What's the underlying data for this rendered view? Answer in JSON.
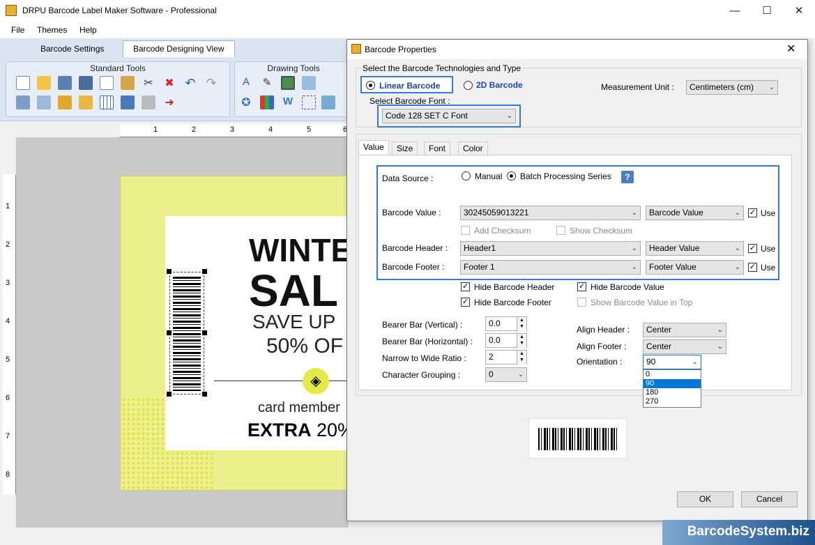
{
  "window": {
    "title": "DRPU Barcode Label Maker Software - Professional"
  },
  "menu": {
    "file": "File",
    "themes": "Themes",
    "help": "Help"
  },
  "tabs": {
    "barcode_settings": "Barcode Settings",
    "designing_view": "Barcode Designing View"
  },
  "ribbon": {
    "standard_tools": "Standard Tools",
    "drawing_tools": "Drawing Tools"
  },
  "ruler": {
    "top": [
      "1",
      "2",
      "3",
      "4",
      "5",
      "6"
    ],
    "left": [
      "1",
      "2",
      "3",
      "4",
      "5",
      "6",
      "7",
      "8"
    ]
  },
  "label": {
    "line1": "WINTE",
    "line2": "SAL",
    "line3": "SAVE UP",
    "line4": "50% OF",
    "line5": "card member",
    "line6_bold": "EXTRA",
    "line6_rest": "20%"
  },
  "dialog": {
    "title": "Barcode Properties",
    "tech_group": "Select the Barcode Technologies and Type",
    "linear": "Linear Barcode",
    "twod": "2D Barcode",
    "measurement_label": "Measurement Unit :",
    "measurement_value": "Centimeters (cm)",
    "font_label": "Select Barcode Font :",
    "font_value": "Code 128 SET C Font",
    "tabs": {
      "value": "Value",
      "size": "Size",
      "font": "Font",
      "color": "Color"
    },
    "data_source_label": "Data Source :",
    "manual": "Manual",
    "batch": "Batch Processing Series",
    "help": "?",
    "barcode_value_label": "Barcode Value :",
    "barcode_value": "30245059013221",
    "barcode_value_src": "Barcode Value",
    "use": "Use",
    "add_checksum": "Add Checksum",
    "show_checksum": "Show Checksum",
    "header_label": "Barcode Header :",
    "header_value": "Header1",
    "header_src": "Header Value",
    "footer_label": "Barcode Footer :",
    "footer_value": "Footer 1",
    "footer_src": "Footer Value",
    "hide_header": "Hide Barcode Header",
    "hide_value": "Hide Barcode Value",
    "hide_footer": "Hide Barcode Footer",
    "show_value_top": "Show Barcode Value in Top",
    "bearer_v_label": "Bearer Bar (Vertical) :",
    "bearer_v": "0.0",
    "bearer_h_label": "Bearer Bar (Horizontal) :",
    "bearer_h": "0.0",
    "ratio_label": "Narrow to Wide Ratio :",
    "ratio": "2",
    "grouping_label": "Character Grouping :",
    "grouping": "0",
    "align_header_label": "Align Header :",
    "align_header": "Center",
    "align_footer_label": "Align Footer :",
    "align_footer": "Center",
    "orientation_label": "Orientation :",
    "orientation": "90",
    "orientation_options": [
      "0",
      "90",
      "180",
      "270"
    ],
    "ok": "OK",
    "cancel": "Cancel"
  },
  "brand": "BarcodeSystem.biz",
  "colors": {
    "accent_blue": "#3a78d6",
    "label_yellow": "#ebf08a",
    "selection": "#0078d7"
  }
}
